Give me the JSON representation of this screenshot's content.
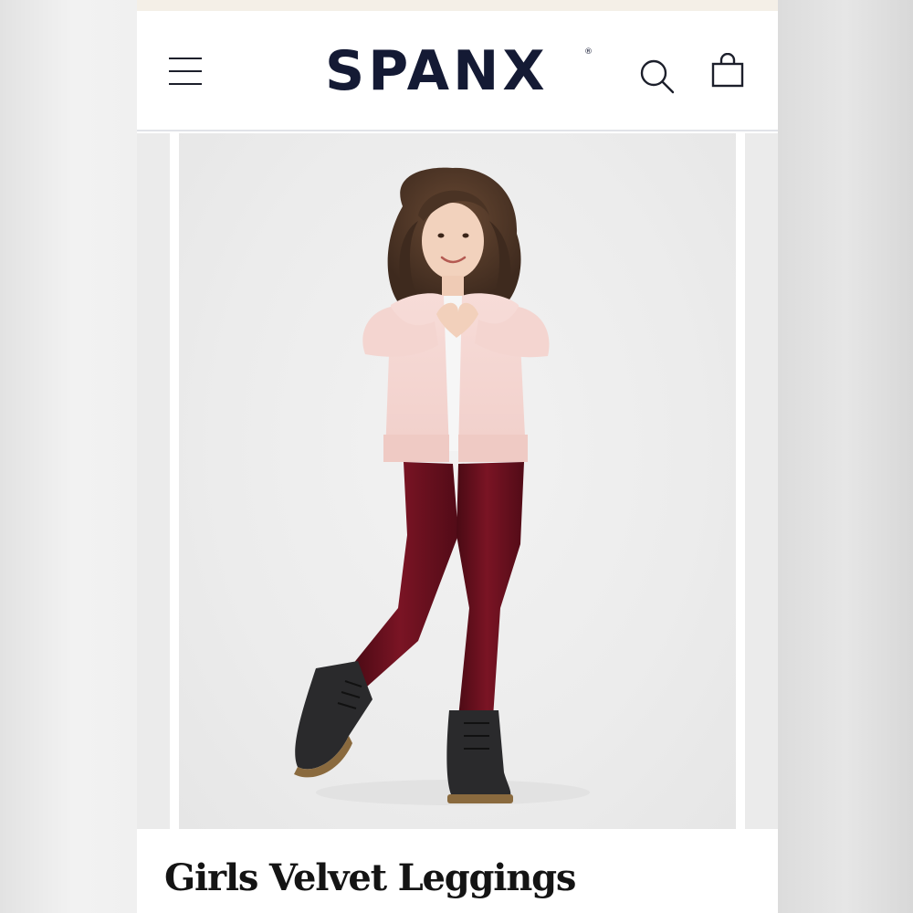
{
  "header": {
    "brand": "SPANX",
    "brand_mark": "®",
    "icons": {
      "menu": "hamburger-menu-icon",
      "search": "search-icon",
      "bag": "shopping-bag-icon"
    }
  },
  "product": {
    "title": "Girls Velvet Leggings"
  },
  "colors": {
    "brand_navy": "#141a34",
    "leggings": "#6e0f1c",
    "cardigan": "#f6d6d2"
  }
}
